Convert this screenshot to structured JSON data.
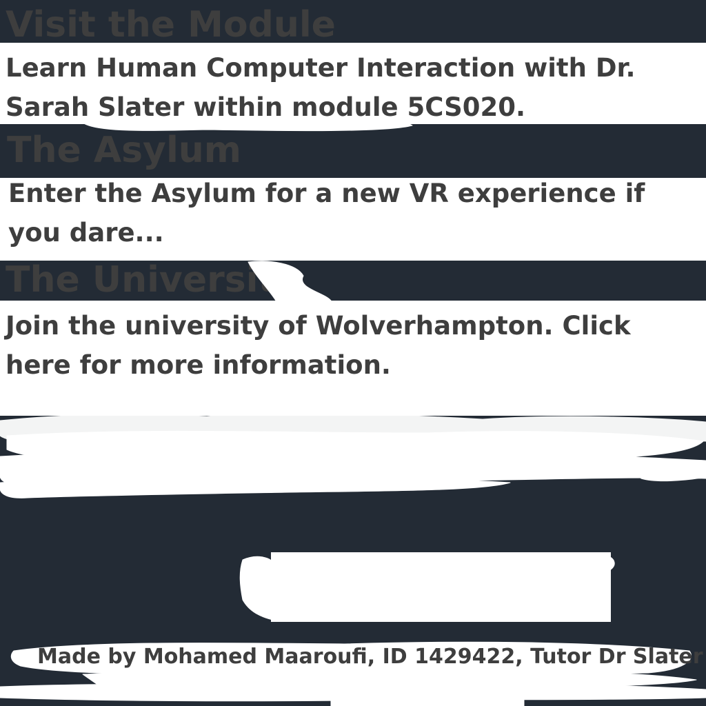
{
  "sections": [
    {
      "heading": "Visit the Module",
      "description": "Learn Human Computer Interaction with Dr. Sarah Slater within module 5CS020."
    },
    {
      "heading": "The Asylum",
      "description": "Enter the Asylum for a new VR experience if you dare..."
    },
    {
      "heading": "The University",
      "description": "Join the university of Wolverhampton. Click here for more information."
    }
  ],
  "footer": {
    "credit": "Made by Mohamed Maaroufi, ID 1429422, Tutor Dr Slater"
  },
  "colors": {
    "band": "#232b35",
    "text": "#3e3e3e",
    "background": "#ffffff"
  }
}
